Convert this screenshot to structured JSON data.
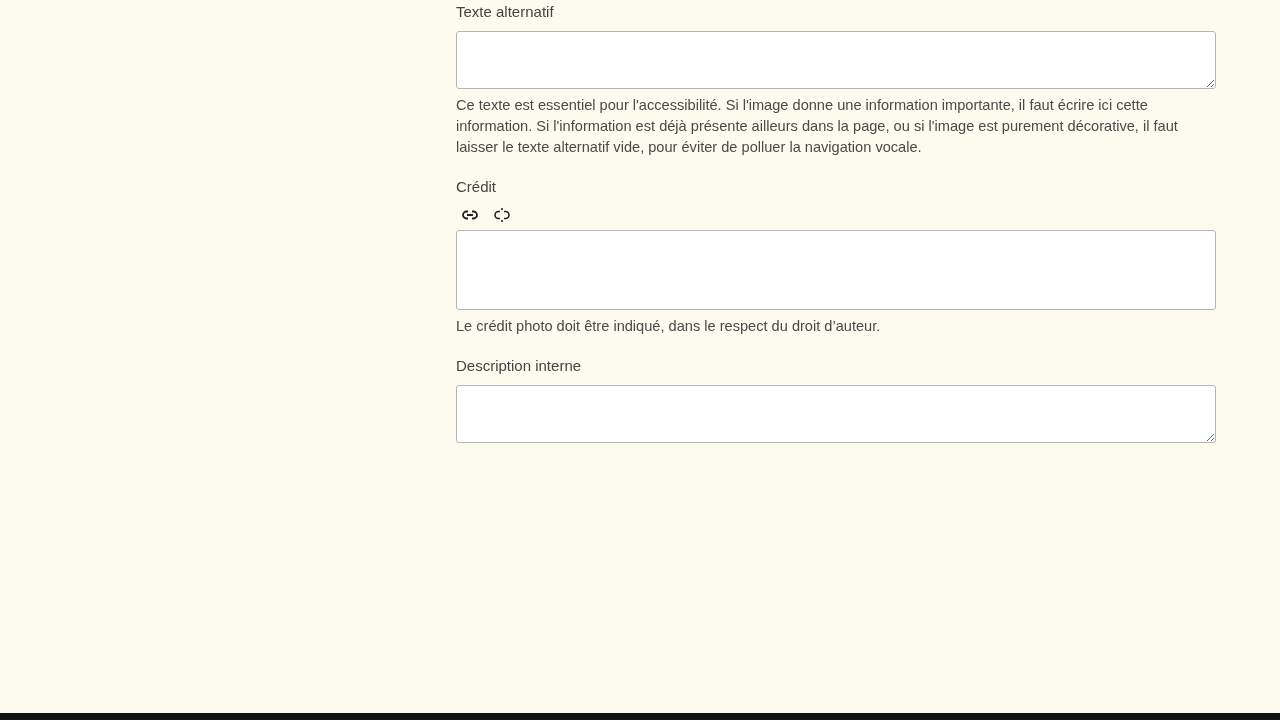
{
  "fields": [
    {
      "kind": "textarea",
      "label": "Texte alternatif",
      "help": "Ce texte est essentiel pour l'accessibilité. Si l'image donne une information importante, il faut écrire ici cette information. Si l'information est déjà présente ailleurs dans la page, ou si l'image est purement décorative, il faut laisser le texte alternatif vide, pour éviter de polluer la navigation vocale."
    },
    {
      "kind": "richtext",
      "label": "Crédit",
      "help": "Le crédit photo doit être indiqué, dans le respect du droit d’auteur."
    },
    {
      "kind": "textarea",
      "label": "Description interne"
    }
  ]
}
